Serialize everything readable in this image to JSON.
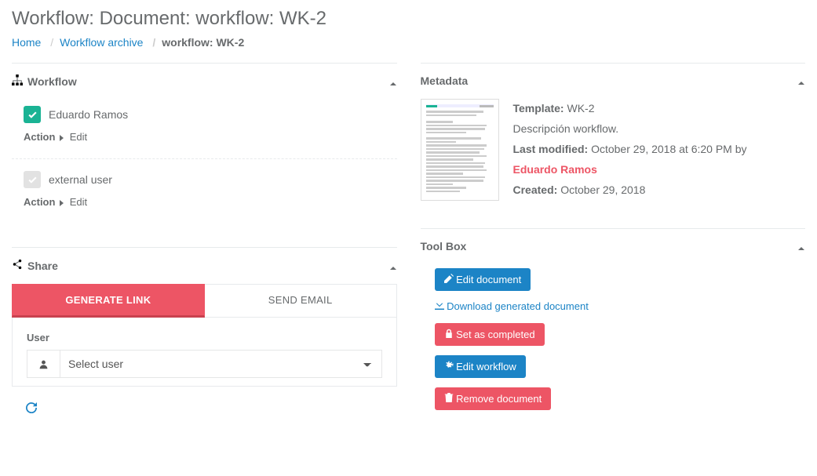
{
  "page": {
    "title": "Workflow: Document: workflow: WK-2"
  },
  "breadcrumb": {
    "home": "Home",
    "archive": "Workflow archive",
    "current": "workflow: WK-2"
  },
  "workflow_panel": {
    "title": "Workflow",
    "steps": [
      {
        "user": "Eduardo Ramos",
        "completed": true,
        "action_label": "Action",
        "action_value": "Edit"
      },
      {
        "user": "external user",
        "completed": false,
        "action_label": "Action",
        "action_value": "Edit"
      }
    ]
  },
  "share_panel": {
    "title": "Share",
    "tabs": {
      "generate": "GENERATE LINK",
      "send": "SEND EMAIL"
    },
    "user_label": "User",
    "user_placeholder": "Select user"
  },
  "metadata_panel": {
    "title": "Metadata",
    "template_label": "Template:",
    "template_value": "WK-2",
    "description": "Descripción workflow.",
    "last_modified_label": "Last modified:",
    "last_modified_value": "October 29, 2018 at 6:20 PM by",
    "last_modified_user": "Eduardo Ramos",
    "created_label": "Created:",
    "created_value": "October 29, 2018"
  },
  "toolbox_panel": {
    "title": "Tool Box",
    "edit_document": "Edit document",
    "download": "Download generated document",
    "set_completed": "Set as completed",
    "edit_workflow": "Edit workflow",
    "remove_document": "Remove document"
  }
}
